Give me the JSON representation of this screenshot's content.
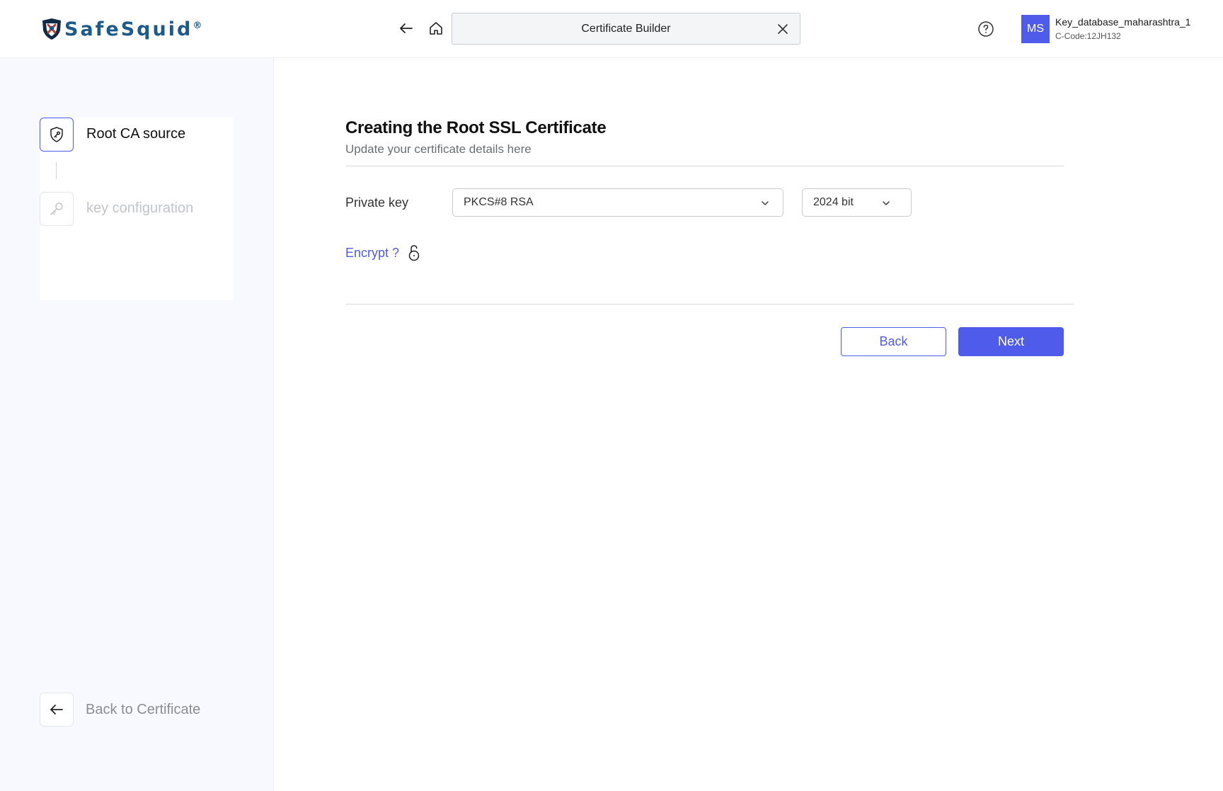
{
  "header": {
    "logo_text": "SafeSquid",
    "logo_mark": "®",
    "search": {
      "value": "Certificate Builder",
      "placeholder": "Certificate Builder"
    },
    "user": {
      "initials": "MS",
      "name": "Key_database_maharashtra_1",
      "code": "C-Code:12JH132"
    },
    "icons": {
      "back": "arrow-left-icon",
      "home": "home-icon",
      "close": "close-icon",
      "help": "help-circle-icon"
    }
  },
  "sidebar": {
    "steps": [
      {
        "label": "Root CA source",
        "icon": "shield-key-icon",
        "state": "active"
      },
      {
        "label": "key configuration",
        "icon": "key-icon",
        "state": "inactive"
      }
    ],
    "back_link": {
      "label": "Back to Certificate",
      "icon": "arrow-left-icon"
    }
  },
  "main": {
    "title": "Creating the Root SSL Certificate",
    "subtitle": "Update your certificate details here",
    "private_key": {
      "label": "Private key",
      "type_value": "PKCS#8 RSA",
      "bits_value": "2024 bit"
    },
    "encrypt": {
      "label": "Encrypt ?",
      "icon": "unlock-icon"
    },
    "buttons": {
      "back": "Back",
      "next": "Next"
    }
  },
  "colors": {
    "accent": "#4f5bea",
    "sidebar_bg": "#f8f9fe",
    "muted_text": "#8a8d93"
  }
}
